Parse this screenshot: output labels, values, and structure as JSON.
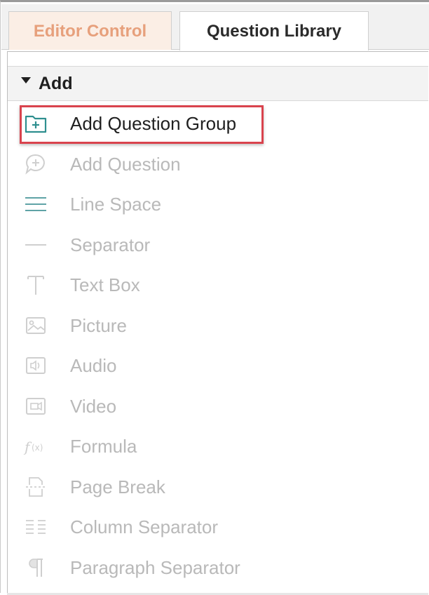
{
  "tabs": [
    {
      "label": "Editor Control",
      "active": false
    },
    {
      "label": "Question Library",
      "active": true
    }
  ],
  "section": {
    "title": "Add",
    "expanded": true
  },
  "items": [
    {
      "label": "Add Question Group",
      "icon": "folder-plus-icon",
      "enabled": true,
      "highlighted": true
    },
    {
      "label": "Add Question",
      "icon": "speech-plus-icon",
      "enabled": false
    },
    {
      "label": "Line Space",
      "icon": "line-space-icon",
      "enabled": false
    },
    {
      "label": "Separator",
      "icon": "separator-line-icon",
      "enabled": false
    },
    {
      "label": "Text Box",
      "icon": "text-t-icon",
      "enabled": false
    },
    {
      "label": "Picture",
      "icon": "picture-icon",
      "enabled": false
    },
    {
      "label": "Audio",
      "icon": "audio-icon",
      "enabled": false
    },
    {
      "label": "Video",
      "icon": "video-icon",
      "enabled": false
    },
    {
      "label": "Formula",
      "icon": "formula-fx-icon",
      "enabled": false
    },
    {
      "label": "Page Break",
      "icon": "page-break-icon",
      "enabled": false
    },
    {
      "label": "Column Separator",
      "icon": "column-separator-icon",
      "enabled": false
    },
    {
      "label": "Paragraph Separator",
      "icon": "pilcrow-icon",
      "enabled": false
    }
  ],
  "colors": {
    "highlight_border": "#d9434d",
    "icon_active": "#2f8f8f",
    "text_disabled": "#b9b9b9",
    "tab_inactive_text": "#e7a07c"
  }
}
